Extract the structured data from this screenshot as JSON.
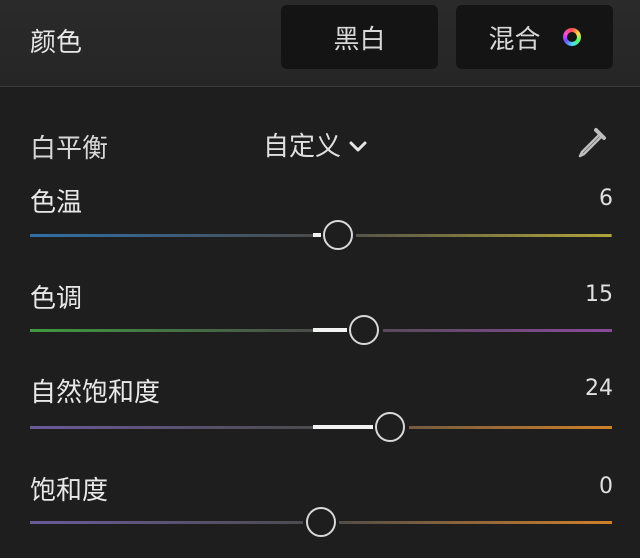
{
  "header": {
    "title": "颜色",
    "bw_label": "黑白",
    "mix_label": "混合",
    "mix_icon": "color-ring-icon"
  },
  "white_balance": {
    "label": "白平衡",
    "selected": "自定义",
    "picker_icon": "eyedropper-icon"
  },
  "sliders": [
    {
      "label": "色温",
      "value": "6",
      "range": [
        -100,
        100
      ],
      "colors": [
        "#2f6fa8",
        "#b0a43a"
      ]
    },
    {
      "label": "色调",
      "value": "15",
      "range": [
        -100,
        100
      ],
      "colors": [
        "#3f9a3f",
        "#8a4a9a"
      ]
    },
    {
      "label": "自然饱和度",
      "value": "24",
      "range": [
        -100,
        100
      ],
      "colors": [
        "#6a5a9a",
        "#d0802a"
      ]
    },
    {
      "label": "饱和度",
      "value": "0",
      "range": [
        -100,
        100
      ],
      "colors": [
        "#6a5a9a",
        "#d0802a"
      ]
    }
  ]
}
